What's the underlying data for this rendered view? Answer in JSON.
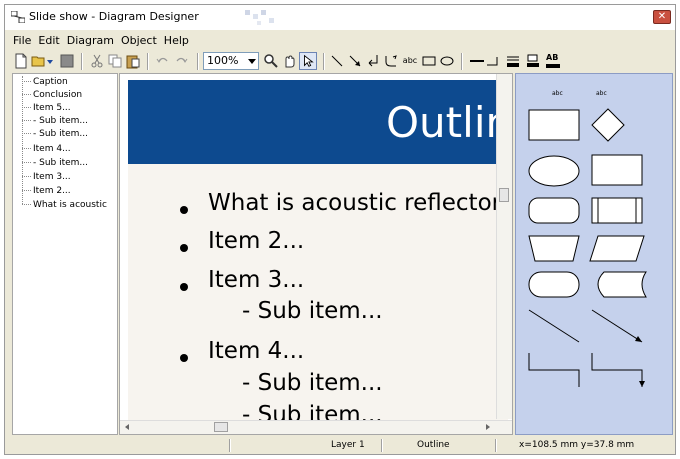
{
  "window": {
    "title": "Slide show - Diagram Designer",
    "close_label": "✕"
  },
  "menu": [
    "File",
    "Edit",
    "Diagram",
    "Object",
    "Help"
  ],
  "toolbar": {
    "zoom_value": "100%",
    "text_tool_label": "abc",
    "format_label": "AB"
  },
  "tree": {
    "items": [
      "Caption",
      "Conclusion",
      "Item 5...",
      "- Sub item...",
      "- Sub item...",
      "Item 4...",
      "- Sub item...",
      "Item 3...",
      "Item 2...",
      "What is acoustic"
    ]
  },
  "slide": {
    "title": "Outline",
    "header_color": "#0d4a8f",
    "bullets": [
      {
        "text": "What is acoustic reflector",
        "level": 1
      },
      {
        "text": "Item 2...",
        "level": 1
      },
      {
        "text": "Item 3...",
        "level": 1
      },
      {
        "text": "- Sub item...",
        "level": 2
      },
      {
        "text": "Item 4...",
        "level": 1
      },
      {
        "text": "- Sub item...",
        "level": 2
      },
      {
        "text": "- Sub item...",
        "level": 2
      }
    ]
  },
  "palette": {
    "background": "#c5d1ec",
    "labels": [
      "abc",
      "abc"
    ],
    "shapes": [
      "rectangle",
      "diamond",
      "ellipse",
      "rectangle",
      "rounded-rectangle",
      "process-box",
      "trapezoid",
      "parallelogram",
      "terminator",
      "stored-data",
      "line",
      "arrow-line",
      "connector-line",
      "connector-arrow"
    ]
  },
  "status": {
    "layer": "Layer 1",
    "page": "Outline",
    "coords": "x=108.5 mm  y=37.8 mm"
  }
}
